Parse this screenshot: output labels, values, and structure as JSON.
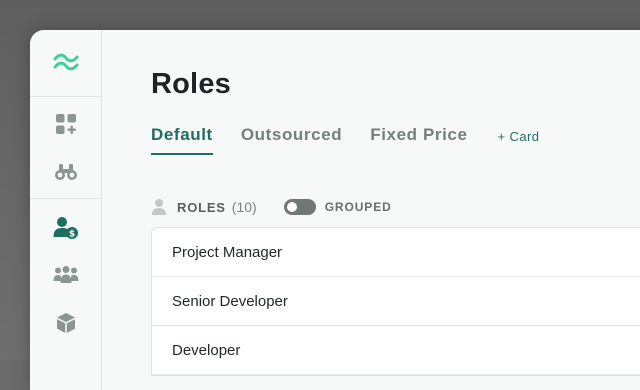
{
  "sidebar": {
    "items": [
      {
        "name": "logo",
        "icon": "waves-logo-icon"
      },
      {
        "name": "dashboard",
        "icon": "widgets-add-icon"
      },
      {
        "name": "explore",
        "icon": "binoculars-icon"
      },
      {
        "name": "roles",
        "icon": "user-dollar-icon",
        "active": true
      },
      {
        "name": "team",
        "icon": "users-group-icon"
      },
      {
        "name": "products",
        "icon": "cube-icon"
      }
    ]
  },
  "page": {
    "title": "Roles"
  },
  "tabs": [
    {
      "label": "Default",
      "active": true
    },
    {
      "label": "Outsourced",
      "active": false
    },
    {
      "label": "Fixed Price",
      "active": false
    }
  ],
  "add_card_label": "+ Card",
  "roles_header": {
    "title": "ROLES",
    "count": "(10)",
    "grouped_label": "GROUPED",
    "grouped_on": false
  },
  "roles": [
    {
      "name": "Project Manager"
    },
    {
      "name": "Senior Developer"
    },
    {
      "name": "Developer"
    }
  ],
  "colors": {
    "accent": "#1e6e61",
    "logo": "#3ecf9a",
    "icon_gray": "#8b9592"
  }
}
